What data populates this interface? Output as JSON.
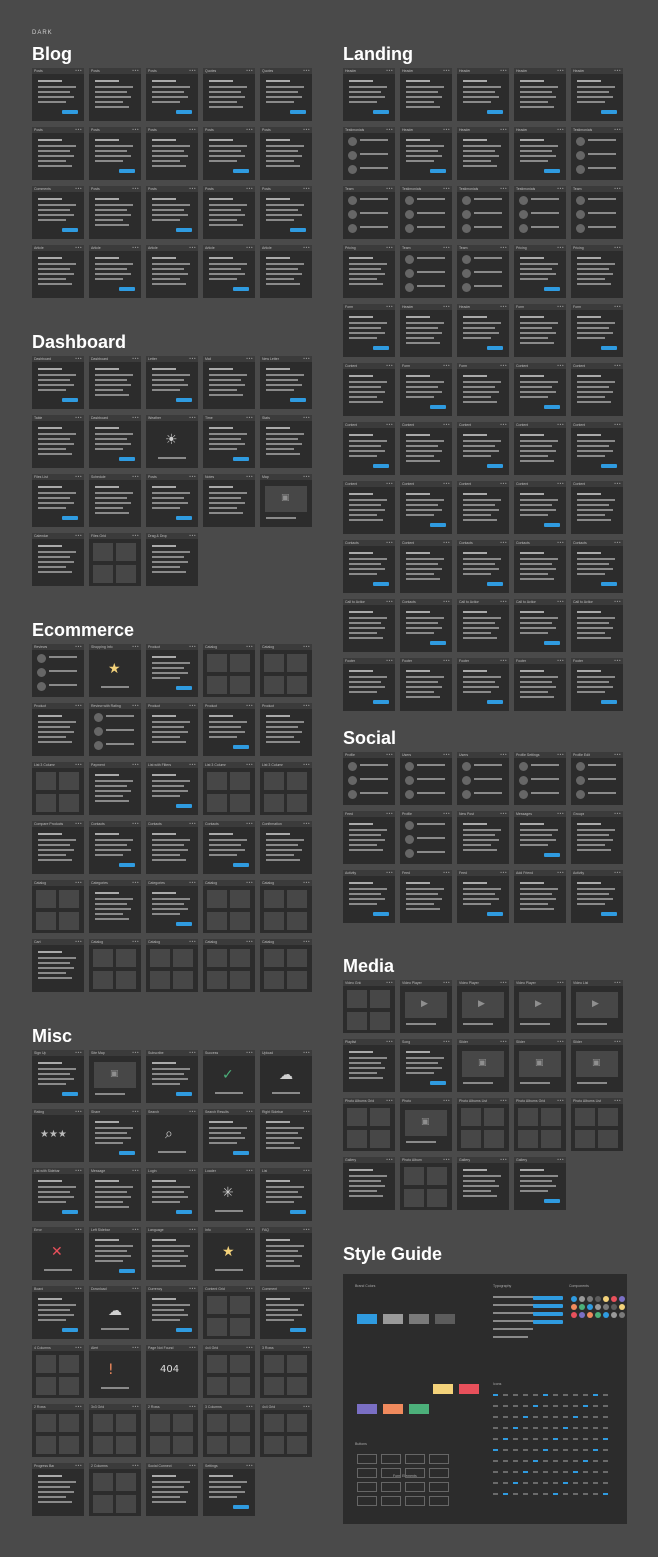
{
  "theme_label": "DARK",
  "sections": [
    {
      "id": "blog",
      "title": "Blog",
      "cards": [
        "Posts",
        "Posts",
        "Posts",
        "Quotes",
        "Quotes",
        "Posts",
        "Posts",
        "Posts",
        "Posts",
        "Posts",
        "Comments",
        "Posts",
        "Posts",
        "Posts",
        "Posts",
        "Article",
        "Article",
        "Article",
        "Article",
        "Article"
      ]
    },
    {
      "id": "dashboard",
      "title": "Dashboard",
      "cards": [
        "Dashboard",
        "Dashboard",
        "Letter",
        "Mail",
        "New Letter",
        "Table",
        "Dashboard",
        "Weather",
        "Time",
        "Stats",
        "Files List",
        "Schedule",
        "Posts",
        "Notes",
        "Map",
        "Calendar",
        "Files Grid",
        "Drag & Drop"
      ]
    },
    {
      "id": "ecommerce",
      "title": "Ecommerce",
      "cards": [
        "Reviews",
        "Shopping Info",
        "Product",
        "Catalog",
        "Catalog",
        "Product",
        "Review with Rating",
        "Product",
        "Product",
        "Product",
        "List 3 Column",
        "Payment",
        "List with Filters",
        "List 3 Column",
        "List 3 Column",
        "Compare Products",
        "Contacts",
        "Contacts",
        "Contacts",
        "Confirmation",
        "Catalog",
        "Categories",
        "Categories",
        "Catalog",
        "Catalog",
        "Cart",
        "Catalog",
        "Catalog",
        "Catalog",
        "Catalog"
      ]
    },
    {
      "id": "misc",
      "title": "Misc",
      "cards": [
        "Sign Up",
        "Site Map",
        "Subscribe",
        "Success",
        "Upload",
        "Rating",
        "Share",
        "Search",
        "Search Results",
        "Right Sidebar",
        "List with Sidebar",
        "Message",
        "Login",
        "Loader",
        "List",
        "Error",
        "Left Sidebar",
        "Language",
        "Info",
        "FAQ",
        "Board",
        "Download",
        "Currency",
        "Content Grid",
        "Comment",
        "4 Columns",
        "Alert",
        "Page Not Found",
        "4x4 Grid",
        "3 Rows",
        "2 Rows",
        "3x3 Grid",
        "2 Rows",
        "3 Columns",
        "4x4 Grid",
        "Progress Bar",
        "2 Columns",
        "Social Connect",
        "Settings"
      ]
    },
    {
      "id": "landing",
      "title": "Landing",
      "cards": [
        "Header",
        "Header",
        "Header",
        "Header",
        "Header",
        "Testimonials",
        "Header",
        "Header",
        "Header",
        "Testimonials",
        "Team",
        "Testimonials",
        "Testimonials",
        "Testimonials",
        "Team",
        "Pricing",
        "Team",
        "Team",
        "Pricing",
        "Pricing",
        "Form",
        "Header",
        "Header",
        "Form",
        "Form",
        "Content",
        "Form",
        "Form",
        "Content",
        "Content",
        "Content",
        "Content",
        "Content",
        "Content",
        "Content",
        "Content",
        "Content",
        "Content",
        "Content",
        "Content",
        "Contacts",
        "Content",
        "Contacts",
        "Contacts",
        "Contacts",
        "Call to Action",
        "Contacts",
        "Call to Action",
        "Call to Action",
        "Call to Action",
        "Footer",
        "Footer",
        "Footer",
        "Footer",
        "Footer"
      ]
    },
    {
      "id": "social",
      "title": "Social",
      "cards": [
        "Profile",
        "Users",
        "Users",
        "Profile Settings",
        "Profile Edit",
        "Feed",
        "Profile",
        "New Post",
        "Messages",
        "Groups",
        "Activity",
        "Feed",
        "Feed",
        "Add Friend",
        "Activity"
      ]
    },
    {
      "id": "media",
      "title": "Media",
      "cards": [
        "Video Grid",
        "Video Player",
        "Video Player",
        "Video Player",
        "Video List",
        "Playlist",
        "Song",
        "Slider",
        "Slider",
        "Slider",
        "Photo Albums Grid",
        "Photo",
        "Photo Albums List",
        "Photo Albums Grid",
        "Photo Albums List",
        "Gallery",
        "Photo Album",
        "Gallery",
        "Gallery"
      ]
    },
    {
      "id": "style",
      "title": "Style Guide",
      "cards": []
    }
  ],
  "style_guide": {
    "labels": [
      "Brand Colors",
      "Typography",
      "Components",
      "Icons",
      "Buttons",
      "Form Elements"
    ],
    "colors": [
      "#2f9be0",
      "#9a9a9a",
      "#7a7a7a",
      "#5c5c5c",
      "#f3d27a",
      "#e8505b",
      "#7a6fc4",
      "#f08a5d",
      "#4cb07a"
    ]
  }
}
